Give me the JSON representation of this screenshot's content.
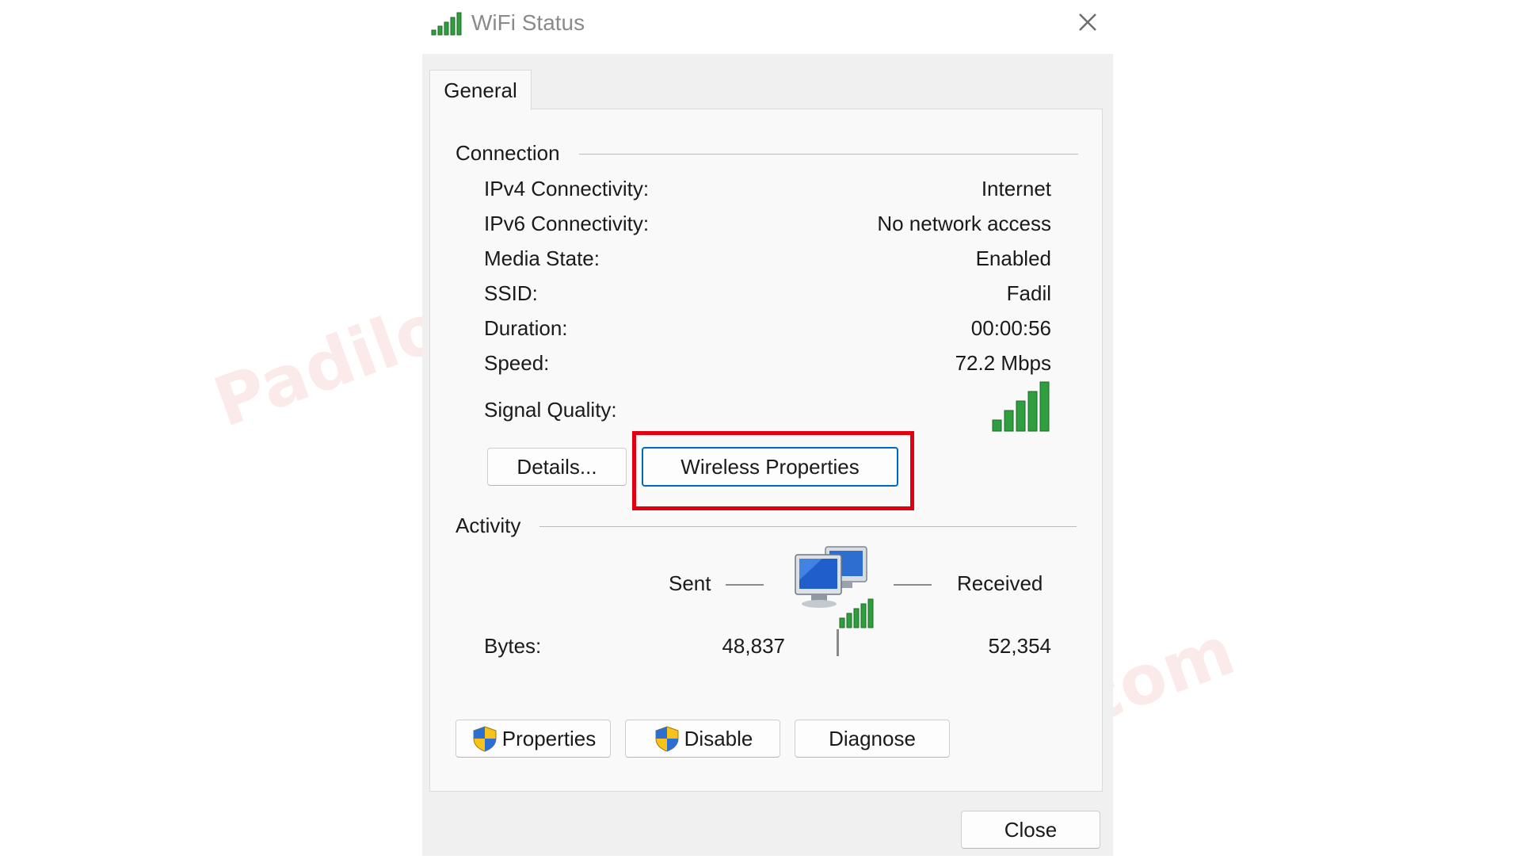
{
  "window": {
    "title": "WiFi Status",
    "tab": "General"
  },
  "connection": {
    "title": "Connection",
    "rows": [
      {
        "label": "IPv4 Connectivity:",
        "value": "Internet"
      },
      {
        "label": "IPv6 Connectivity:",
        "value": "No network access"
      },
      {
        "label": "Media State:",
        "value": "Enabled"
      },
      {
        "label": "SSID:",
        "value": "Fadil"
      },
      {
        "label": "Duration:",
        "value": "00:00:56"
      },
      {
        "label": "Speed:",
        "value": "72.2 Mbps"
      }
    ],
    "signal_label": "Signal Quality:",
    "signal_bars": 5,
    "details_button": "Details...",
    "wireless_button": "Wireless Properties"
  },
  "activity": {
    "title": "Activity",
    "sent_label": "Sent",
    "received_label": "Received",
    "bytes_label": "Bytes:",
    "bytes_sent": "48,837",
    "bytes_received": "52,354"
  },
  "buttons": {
    "properties": "Properties",
    "disable": "Disable",
    "diagnose": "Diagnose",
    "close": "Close"
  },
  "watermark": "Padilong.com",
  "colors": {
    "signal_green": "#2e9e3e",
    "highlight_red": "#e0000f",
    "accent_blue": "#0067c0"
  }
}
